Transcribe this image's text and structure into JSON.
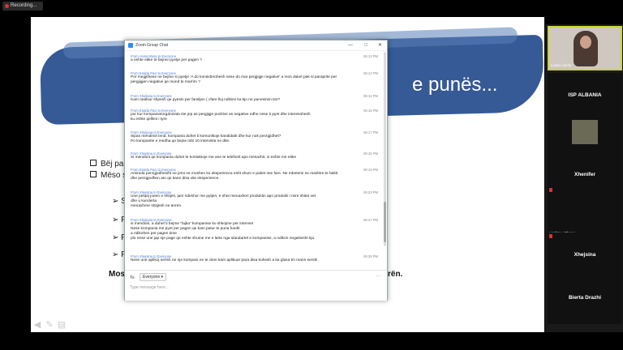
{
  "recording": {
    "label": "Recording..."
  },
  "slide": {
    "title": "e punës...",
    "bullets": [
      "Bëj pak",
      "Mëso s"
    ],
    "arrows": [
      "S",
      "F",
      "F",
      "F"
    ],
    "footer_left": "Mos",
    "footer_right": "rën."
  },
  "chat": {
    "window_title": "Zoom Group Chat",
    "messages": [
      {
        "from": "Anisa Musa",
        "to": "Everyone",
        "time": "06:13 PM",
        "lines": [
          "a eshte etike te bejme pyetje per pagen ?"
        ]
      },
      {
        "from": "Eralda Paci",
        "to": "Everyone",
        "time": "06:13 PM",
        "lines": [
          "Por megjithese ne bejme si pyetje 'A do konsiderohesh nese do mar pergjigje negative' a mos duket pak si paraprite per",
          "pergjigjen negative qe mund te marrim ?"
        ]
      },
      {
        "from": "Xhuljana",
        "to": "Everyone",
        "time": "06:14 PM",
        "lines": [
          "Kam rastisur shpesh qe pyesin per familjen ( cfare lloj ndikimi ka kjo ne punesimin tim?"
        ]
      },
      {
        "from": "Eralda Paci",
        "to": "Everyone",
        "time": "06:16 PM",
        "lines": [
          "por kur kompania/organizata ste jep as pergjigje pozitive as negative edhe nese ti pyet dhe interesohesh",
          "ku eshte qellimi i tyre"
        ]
      },
      {
        "from": "Xhuljana",
        "to": "Everyone",
        "time": "06:17 PM",
        "lines": [
          "Sipas mendimit tend, kompania duhet ti komunikoje kandidatit dhe kur nuk perzgjidhet?",
          "Po kompanite e medha qe bejne mbi 10 intervista ne dite."
        ]
      },
      {
        "from": "Xhejsina",
        "to": "Everyone",
        "time": "06:18 PM",
        "lines": [
          "Si mendoni qe kompania duhet te kontaktoje me ane te telefonit apo mesazhit, si eshte me etike"
        ]
      },
      {
        "from": "Eralda Paci",
        "to": "Everyone",
        "time": "06:19 PM",
        "lines": [
          "Arsimda perzgjedhesiht ne jemi ne moshen ku eksperienca esht shum e paket ose fare. Ne mbetemi ne mashire te fatitit",
          "dhe perzgjedhen ato qe kane disa vite eksperience."
        ]
      },
      {
        "from": "Xhejsina",
        "to": "Everyone",
        "time": "06:23 PM",
        "lines": [
          "Une pelqej joeen e shitjes, jam ndeshur me pytjen, e shet menaxheri produktin apo produkti i mire shitet vet",
          "dhe u kundertа",
          "menaxhere shitjesh ne terren"
        ]
      },
      {
        "from": "Xhuljana",
        "to": "Everyone",
        "time": "06:27 PM",
        "lines": [
          "si mendoni, a duhet ti bejme \"lajka\" kompanise ku shkojme per interviet",
          "Nese kompania me pyet per pagen qe kam patur te puna fundit",
          "a ndikohen per pagen time",
          "plo nese une jap nje page qe eshte shume me e larte nga standartet e kompanise, a ndikon negativisht kjo."
        ]
      },
      {
        "from": "Xhejsina",
        "to": "Everyone",
        "time": "06:29 PM",
        "lines": [
          "Nese une aplikoj serish ne nje kompani ne te cilen kam aplikuar para disa kohesh a ka glasa tm marin sershi"
        ]
      }
    ],
    "to_label": "To:",
    "recipient": "Everyone",
    "input_placeholder": "Type message here..."
  },
  "participants": {
    "self_name": "Linda Lluzzo",
    "tiles": [
      {
        "name": "ISP ALBANIA",
        "sub": ""
      },
      {
        "name": "",
        "sub": "Sara Kotreli"
      },
      {
        "name": "Xhenifer",
        "sub": ""
      },
      {
        "name": "",
        "sub": "Lindita L iPhone"
      },
      {
        "name": "Xhejsina",
        "sub": ""
      },
      {
        "name": "Bierta Drazhi",
        "sub": ""
      }
    ]
  },
  "colors": {
    "accent": "#2d8cff",
    "slide_brush": "#355a96",
    "active_speaker": "#c9d43a"
  }
}
